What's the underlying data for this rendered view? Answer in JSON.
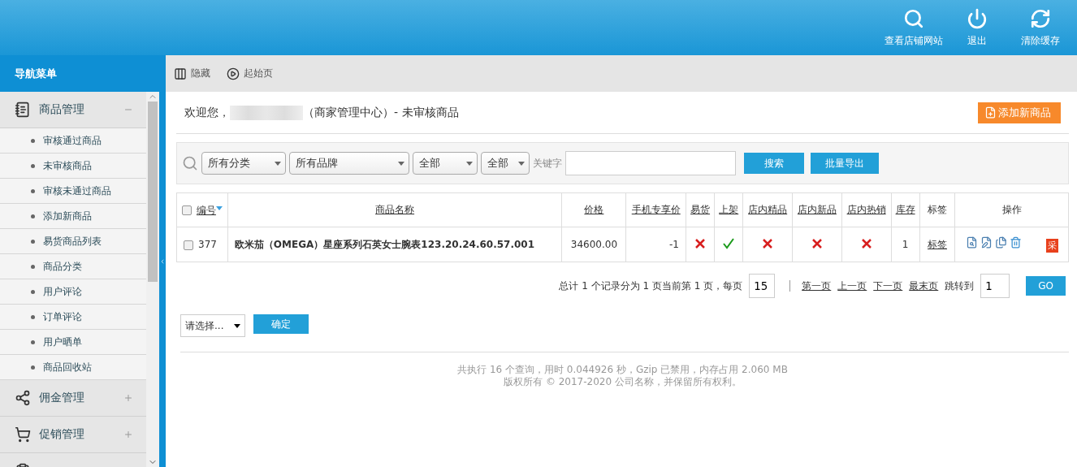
{
  "header": {
    "actions": [
      {
        "kind": "search",
        "label": "查看店铺网站"
      },
      {
        "kind": "power",
        "label": "退出"
      },
      {
        "kind": "refresh",
        "label": "清除缓存"
      }
    ]
  },
  "sidebar": {
    "title": "导航菜单",
    "groups": [
      {
        "kind": "notepad",
        "label": "商品管理",
        "expanded": true,
        "items": [
          {
            "label": "审核通过商品"
          },
          {
            "label": "未审核商品"
          },
          {
            "label": "审核未通过商品"
          },
          {
            "label": "添加新商品"
          },
          {
            "label": "易货商品列表"
          },
          {
            "label": "商品分类"
          },
          {
            "label": "用户评论"
          },
          {
            "label": "订单评论"
          },
          {
            "label": "用户晒单"
          },
          {
            "label": "商品回收站"
          }
        ]
      },
      {
        "kind": "share",
        "label": "佣金管理",
        "expanded": false
      },
      {
        "kind": "cart",
        "label": "促销管理",
        "expanded": false
      },
      {
        "kind": "order",
        "expanded": false
      }
    ]
  },
  "toolbar": [
    {
      "kind": "hide",
      "label": "隐藏"
    },
    {
      "kind": "play",
      "label": "起始页"
    }
  ],
  "page": {
    "welcome": "欢迎您，",
    "subtitle": "（商家管理中心）- 未审核商品",
    "add_button": "添加新商品"
  },
  "filters": {
    "selects": [
      {
        "value": "所有分类",
        "wide": false
      },
      {
        "value": "所有品牌",
        "wide": true
      },
      {
        "value": "全部",
        "wide": false
      },
      {
        "value": "全部",
        "wide": false
      }
    ],
    "keyword_label": "关键字",
    "search_button": "搜索",
    "export_button": "批量导出"
  },
  "table": {
    "select_all_checked": false,
    "columns": [
      {
        "label": "编号",
        "link": true,
        "sorted": true
      },
      {
        "label": "商品名称",
        "link": true,
        "sorted": false
      },
      {
        "label": "价格",
        "link": true,
        "sorted": false
      },
      {
        "label": "手机专享价",
        "link": true,
        "sorted": false
      },
      {
        "label": "易货",
        "link": true,
        "sorted": false
      },
      {
        "label": "上架",
        "link": true,
        "sorted": false
      },
      {
        "label": "店内精品",
        "link": true,
        "sorted": false
      },
      {
        "label": "店内新品",
        "link": true,
        "sorted": false
      },
      {
        "label": "店内热销",
        "link": true,
        "sorted": false
      },
      {
        "label": "库存",
        "link": true,
        "sorted": false
      },
      {
        "label": "标签",
        "link": false,
        "sorted": false
      },
      {
        "label": "操作",
        "link": false,
        "sorted": false
      }
    ],
    "rows": [
      {
        "checked": false,
        "id": "377",
        "name": "欧米茄（OMEGA）星座系列石英女士腕表123.20.24.60.57.001",
        "price": "34600.00",
        "mobile_price": "-1",
        "flags": [
          false,
          true,
          false,
          false,
          false
        ],
        "stock": "1",
        "tag": "标签",
        "collect": "采"
      }
    ]
  },
  "pager": {
    "summary": "总计 1 个记录分为 1 页当前第 1 页，每页",
    "per_page": "15",
    "links": [
      "第一页",
      "上一页",
      "下一页",
      "最末页"
    ],
    "jump_label": "跳转到",
    "jump_value": "1",
    "go": "GO"
  },
  "batch": {
    "select": "请选择...",
    "confirm": "确定"
  },
  "footer": [
    "共执行 16 个查询，用时 0.044926 秒，Gzip 已禁用，内存占用 2.060 MB",
    "版权所有 © 2017-2020 公司名称，并保留所有权利。"
  ]
}
